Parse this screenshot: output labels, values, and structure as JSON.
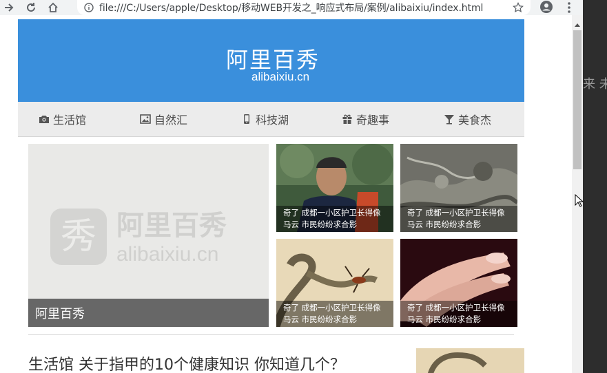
{
  "browser": {
    "url": "file:///C:/Users/apple/Desktop/移动WEB开发之_响应式布局/案例/alibaixiu/index.html"
  },
  "side_panel": {
    "text": "来 未"
  },
  "header": {
    "title": "阿里百秀",
    "subtitle": "alibaixiu.cn",
    "bg_color": "#3a8fdc"
  },
  "nav": {
    "items": [
      {
        "label": "生活馆",
        "icon": "camera-icon"
      },
      {
        "label": "自然汇",
        "icon": "picture-icon"
      },
      {
        "label": "科技湖",
        "icon": "phone-icon"
      },
      {
        "label": "奇趣事",
        "icon": "gift-icon"
      },
      {
        "label": "美食杰",
        "icon": "cocktail-icon"
      }
    ]
  },
  "featured": {
    "caption": "阿里百秀",
    "watermark_title": "阿里百秀",
    "watermark_sub": "alibaixiu.cn",
    "watermark_glyph": "秀"
  },
  "tiles": [
    {
      "line1": "奇了 成都一小区护卫长得像",
      "line2": "马云 市民纷纷求合影"
    },
    {
      "line1": "奇了 成都一小区护卫长得像",
      "line2": "马云 市民纷纷求合影"
    },
    {
      "line1": "奇了 成都一小区护卫长得像",
      "line2": "马云 市民纷纷求合影"
    },
    {
      "line1": "奇了 成都一小区护卫长得像",
      "line2": "马云 市民纷纷求合影"
    }
  ],
  "article": {
    "title": "生活馆 关于指甲的10个健康知识 你知道几个？"
  }
}
